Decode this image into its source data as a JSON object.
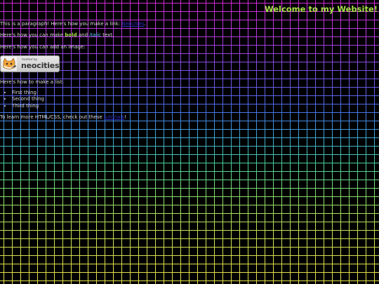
{
  "page": {
    "title": "Welcome to my Website!"
  },
  "intro": {
    "before": "This is a paragraph! Here's how you make a link: ",
    "link": "Neocities",
    "after": "."
  },
  "formatting": {
    "before": "Here's how you can make ",
    "bold": "bold",
    "middle": " and ",
    "italic": "italic",
    "after": " text."
  },
  "image_section": {
    "text": "Here's how you can add an image:",
    "badge": {
      "small_text": "hosted by",
      "big_text": "neocities",
      "icon": "neocities-cat-icon"
    }
  },
  "list_section": {
    "text": "Here's how to make a list:",
    "items": [
      "First thing",
      "Second thing",
      "Third thing"
    ]
  },
  "outro": {
    "before": "To learn more HTML/CSS, check out these ",
    "link": "tutorials",
    "after": "!"
  },
  "colors": {
    "background": "#000000",
    "title": "#a8e04a",
    "link": "#2d2dbf",
    "bold": "#a8e04a",
    "italic": "#5fc8ff",
    "grid_top": "#d32bd6",
    "grid_middle": "#3fa8d8",
    "grid_bottom": "#e9e04a"
  }
}
